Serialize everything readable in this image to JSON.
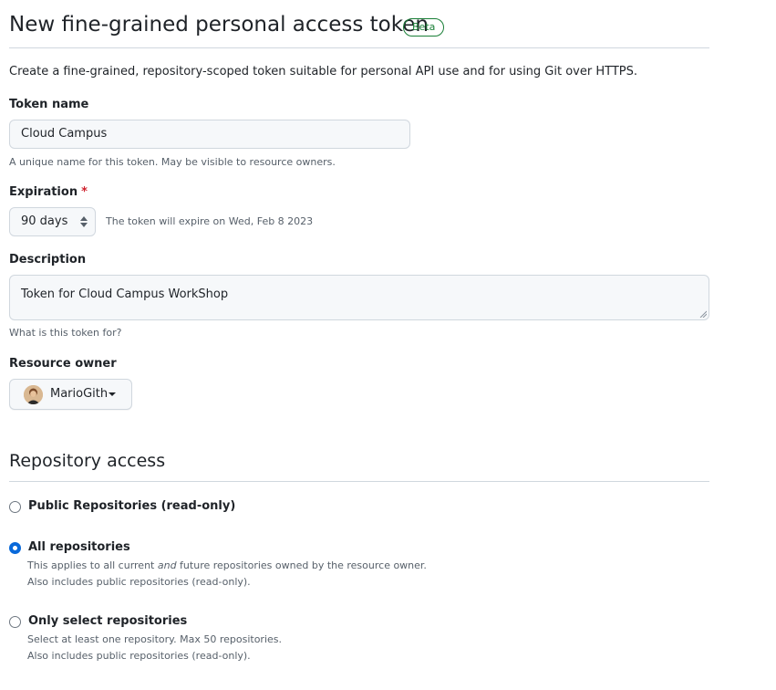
{
  "header": {
    "title": "New fine-grained personal access token",
    "badge": "Beta"
  },
  "intro": "Create a fine-grained, repository-scoped token suitable for personal API use and for using Git over HTTPS.",
  "token_name": {
    "label": "Token name",
    "value": "Cloud Campus",
    "note": "A unique name for this token. May be visible to resource owners."
  },
  "expiration": {
    "label": "Expiration",
    "required_mark": "*",
    "selected": "90 days",
    "note": "The token will expire on Wed, Feb 8 2023"
  },
  "description": {
    "label": "Description",
    "value": "Token for Cloud Campus WorkShop",
    "note": "What is this token for?"
  },
  "resource_owner": {
    "label": "Resource owner",
    "selected": "MarioGith"
  },
  "repository_access": {
    "title": "Repository access",
    "options": [
      {
        "label": "Public Repositories (read-only)",
        "checked": false,
        "desc": []
      },
      {
        "label": "All repositories",
        "checked": true,
        "desc_pre": "This applies to all current ",
        "desc_em": "and",
        "desc_post": " future repositories owned by the resource owner.",
        "desc2": "Also includes public repositories (read-only)."
      },
      {
        "label": "Only select repositories",
        "checked": false,
        "desc1": "Select at least one repository. Max 50 repositories.",
        "desc2": "Also includes public repositories (read-only)."
      }
    ]
  },
  "colors": {
    "accent": "#0969da",
    "badge": "#1a7f37",
    "required": "#cf222e"
  }
}
